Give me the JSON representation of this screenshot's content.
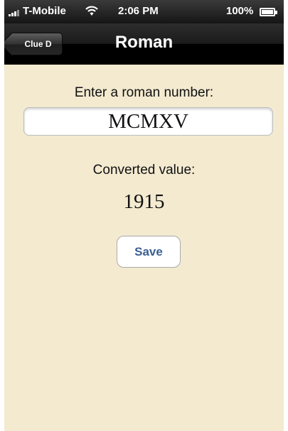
{
  "status_bar": {
    "carrier": "T-Mobile",
    "time": "2:06 PM",
    "battery": "100%",
    "battery_level": 1.0,
    "icons": [
      "signal-icon",
      "wifi-icon",
      "battery-icon"
    ]
  },
  "nav": {
    "back_label": "Clue D",
    "title": "Roman"
  },
  "form": {
    "prompt": "Enter a roman number:",
    "input_value": "MCMXV",
    "converted_label": "Converted value:",
    "converted_value": "1915",
    "save_label": "Save"
  },
  "colors": {
    "background": "#f3ead0",
    "save_text": "#3b5f93",
    "bar": "#000000"
  }
}
